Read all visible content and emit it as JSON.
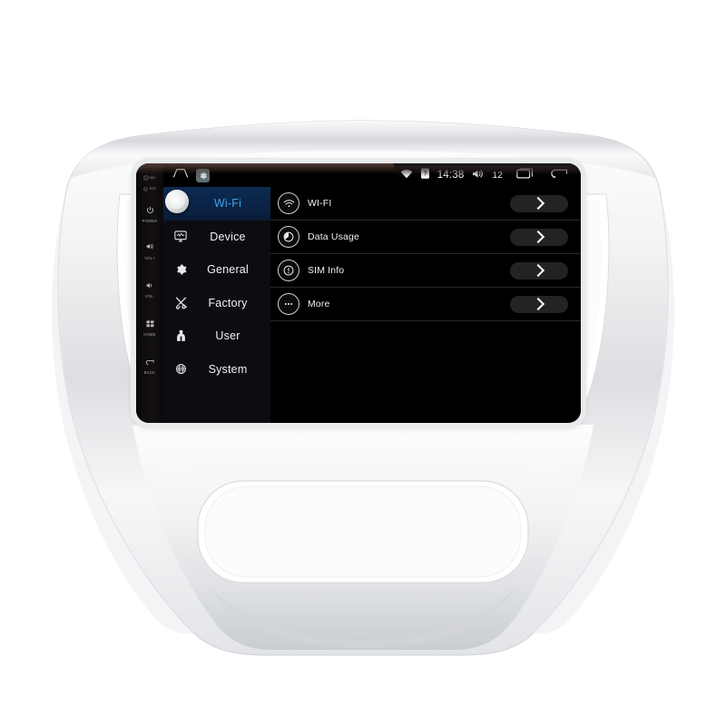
{
  "device": {
    "type": "car-stereo-head-unit",
    "bezel_color": "#e9eaec",
    "screen_bg": "#000000"
  },
  "hardkeys": [
    {
      "label": "MIC",
      "icon": "led-dot-icon",
      "style": "tiny"
    },
    {
      "label": "RST",
      "icon": "led-dot-icon",
      "style": "tiny"
    },
    {
      "label": "POWER",
      "icon": "power-icon",
      "style": "normal"
    },
    {
      "label": "VOL+",
      "icon": "volume-up-icon",
      "style": "normal"
    },
    {
      "label": "VOL-",
      "icon": "volume-down-icon",
      "style": "normal"
    },
    {
      "label": "HOME",
      "icon": "home-grid-icon",
      "style": "normal"
    },
    {
      "label": "BACK",
      "icon": "back-arrow-icon",
      "style": "normal"
    }
  ],
  "statusbar": {
    "home_icon": "home-icon",
    "settings_icon": "gear-icon",
    "wifi_icon": "wifi-icon",
    "sim_icon": "sim-card-icon",
    "clock": "14:38",
    "volume_icon": "speaker-icon",
    "volume_level": "12",
    "recents_icon": "recents-icon",
    "back_icon": "back-arrow-icon",
    "accent": "#5f6e74"
  },
  "sidebar": {
    "active_color": "#3aa8f0",
    "items": [
      {
        "label": "Wi-Fi",
        "icon": "knob-icon",
        "active": true
      },
      {
        "label": "Device",
        "icon": "display-icon",
        "active": false
      },
      {
        "label": "General",
        "icon": "gear-icon",
        "active": false
      },
      {
        "label": "Factory",
        "icon": "tools-icon",
        "active": false
      },
      {
        "label": "User",
        "icon": "person-icon",
        "active": false
      },
      {
        "label": "System",
        "icon": "globe-icon",
        "active": false
      }
    ]
  },
  "content": {
    "rows": [
      {
        "label": "WI-FI",
        "icon": "wifi-circle-icon",
        "action_icon": "chevron-right-icon"
      },
      {
        "label": "Data Usage",
        "icon": "data-usage-circle-icon",
        "action_icon": "chevron-right-icon"
      },
      {
        "label": "SIM Info",
        "icon": "sim-info-circle-icon",
        "action_icon": "chevron-right-icon"
      },
      {
        "label": "More",
        "icon": "more-dots-circle-icon",
        "action_icon": "chevron-right-icon"
      }
    ],
    "watermark": "······"
  }
}
